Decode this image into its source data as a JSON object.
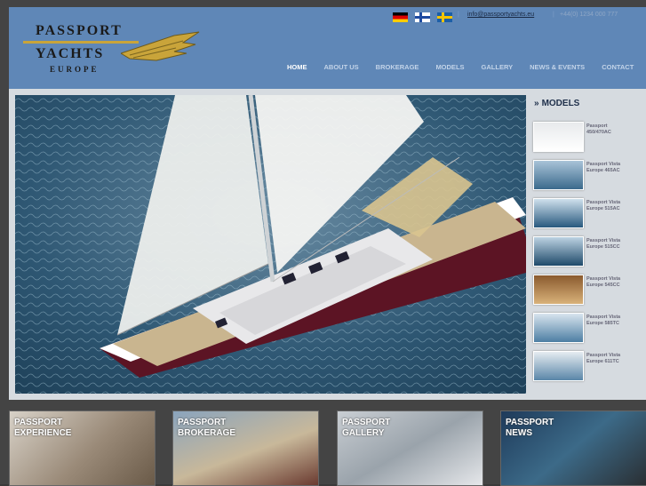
{
  "header": {
    "logo": {
      "line1": "PASSPORT",
      "line2": "YACHTS",
      "line3": "EUROPE"
    },
    "flags": [
      "flag-de-icon",
      "flag-fi-icon",
      "flag-se-icon"
    ],
    "email": "info@passportyachts.eu",
    "phone": "+44(0) 1234 000 777"
  },
  "nav": {
    "items": [
      {
        "label": "HOME",
        "active": true
      },
      {
        "label": "ABOUT US"
      },
      {
        "label": "BROKERAGE"
      },
      {
        "label": "MODELS"
      },
      {
        "label": "GALLERY"
      },
      {
        "label": "NEWS & EVENTS"
      },
      {
        "label": "CONTACT"
      }
    ]
  },
  "sidebar": {
    "title": "MODELS",
    "models": [
      {
        "line1": "Passport",
        "line2": "450/470AC"
      },
      {
        "line1": "Passport Vista",
        "line2": "Europe 465AC"
      },
      {
        "line1": "Passport Vista",
        "line2": "Europe 515AC"
      },
      {
        "line1": "Passport Vista",
        "line2": "Europe 515CC"
      },
      {
        "line1": "Passport Vista",
        "line2": "Europe 545CC"
      },
      {
        "line1": "Passport Vista",
        "line2": "Europe 585TC"
      },
      {
        "line1": "Passport Vista",
        "line2": "Europe 611TC"
      }
    ]
  },
  "tiles": [
    {
      "line1": "PASSPORT",
      "line2": "EXPERIENCE"
    },
    {
      "line1": "PASSPORT",
      "line2": "BROKERAGE"
    },
    {
      "line1": "PASSPORT",
      "line2": "GALLERY"
    },
    {
      "line1": "PASSPORT",
      "line2": "NEWS"
    }
  ],
  "colors": {
    "header_bg": "#5f87b7",
    "logo_gold": "#c9a43a",
    "hull_red": "#5c1424"
  }
}
